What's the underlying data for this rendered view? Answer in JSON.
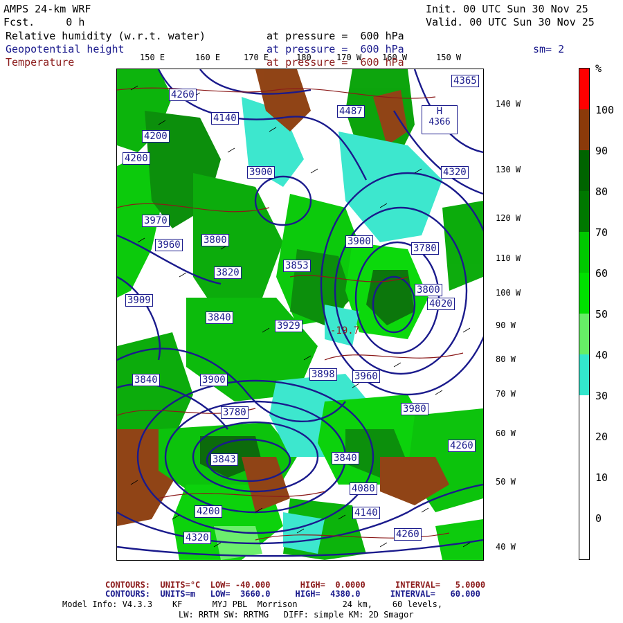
{
  "header": {
    "title": "AMPS 24-km WRF",
    "fcst": "Fcst.     0 h",
    "init": "Init. 00 UTC Sun 30 Nov 25",
    "valid": "Valid. 00 UTC Sun 30 Nov 25",
    "field1_name": "Relative humidity (w.r.t. water)",
    "field1_level": "at pressure =  600 hPa",
    "field2_name": "Geopotential height",
    "field2_level": "at pressure =  600 hPa",
    "field3_name": "Temperature",
    "field3_level": "at pressure =  600 hPa",
    "smoothing": "sm= 2"
  },
  "longitude_labels": [
    "150 E",
    "160 E",
    "170 E",
    "180",
    "170 W",
    "160 W",
    "150 W"
  ],
  "latitude_labels": [
    "140 W",
    "130 W",
    "120 W",
    "110 W",
    "100 W",
    "90 W",
    "80 W",
    "70 W",
    "60 W",
    "50 W",
    "40 W"
  ],
  "colorbar": {
    "unit": "%",
    "labels": [
      "100",
      "90",
      "80",
      "70",
      "60",
      "50",
      "40",
      "30",
      "20",
      "10",
      "0"
    ],
    "colors": [
      "#ff0000",
      "#8b3a0a",
      "#006400",
      "#007800",
      "#00c800",
      "#00e000",
      "#66ee66",
      "#33e6cc",
      "#ffffff",
      "#ffffff",
      "#ffffff",
      "#ffffff"
    ]
  },
  "height_labels": [
    "4365",
    "4366",
    "4320",
    "4487",
    "4260",
    "4140",
    "4200",
    "4200",
    "3900",
    "3970",
    "3960",
    "3820",
    "3853",
    "3800",
    "3780",
    "3900",
    "3909",
    "3840",
    "3929",
    "3898",
    "3840",
    "3980",
    "3780",
    "3843",
    "3840",
    "4080",
    "4140",
    "4200",
    "4320",
    "4260",
    "4260",
    "3960",
    "4020",
    "3900",
    "3800"
  ],
  "high_low_markers": [
    {
      "kind": "H",
      "value": "4366"
    },
    {
      "kind": "H",
      "value": "4487"
    }
  ],
  "temperature_label": "-19.7",
  "footer": {
    "contours_t": "CONTOURS:  UNITS=°C  LOW= -40.000      HIGH=  0.0000      INTERVAL=   5.0000",
    "contours_z": "CONTOURS:  UNITS=m   LOW=  3660.0     HIGH=  4380.0      INTERVAL=   60.000",
    "model_info": "Model Info: V4.3.3    KF      MYJ PBL  Morrison         24 km,    60 levels,",
    "physics": "LW: RRTM SW: RRTMG   DIFF: simple KM: 2D Smagor"
  }
}
